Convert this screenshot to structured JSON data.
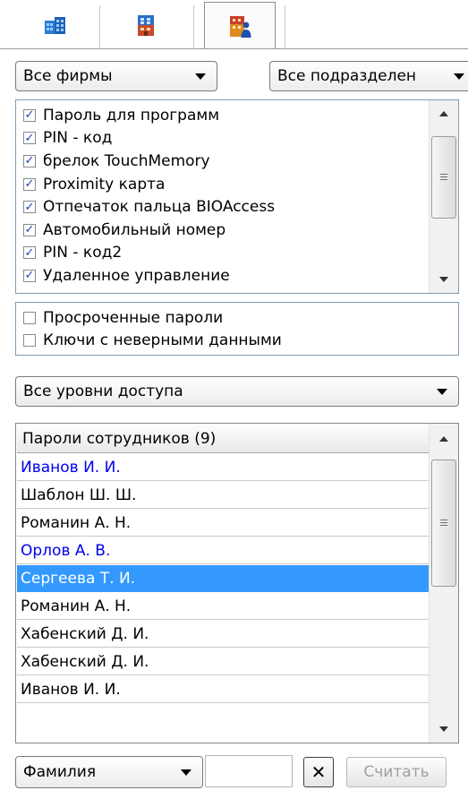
{
  "tabs": [
    {
      "icon": "buildings-icon",
      "active": false
    },
    {
      "icon": "building-icon",
      "active": false
    },
    {
      "icon": "building-person-icon",
      "active": true
    }
  ],
  "filters": {
    "company_select": "Все фирмы",
    "department_select": "Все подразделен"
  },
  "key_types": {
    "items": [
      {
        "label": "Пароль для программ",
        "checked": true
      },
      {
        "label": "PIN - код",
        "checked": true
      },
      {
        "label": "брелок TouchMemory",
        "checked": true
      },
      {
        "label": "Proximity карта",
        "checked": true
      },
      {
        "label": "Отпечаток пальца BIOAccess",
        "checked": true
      },
      {
        "label": "Автомобильный номер",
        "checked": true
      },
      {
        "label": "PIN - код2",
        "checked": true
      },
      {
        "label": "Удаленное управление",
        "checked": true
      }
    ]
  },
  "special_filters": {
    "items": [
      {
        "label": "Просроченные пароли",
        "checked": false
      },
      {
        "label": "Ключи с неверными данными",
        "checked": false
      }
    ]
  },
  "access_level_select": "Все уровни доступа",
  "employees": {
    "header": "Пароли сотрудников  (9)",
    "rows": [
      {
        "name": "Иванов И. И.",
        "color": "#0000ee",
        "selected": false
      },
      {
        "name": "Шаблон Ш. Ш.",
        "color": "#000000",
        "selected": false
      },
      {
        "name": "Романин А. Н.",
        "color": "#000000",
        "selected": false
      },
      {
        "name": "Орлов А. В.",
        "color": "#0000ee",
        "selected": false
      },
      {
        "name": "Сергеева Т. И.",
        "color": "#ffffff",
        "selected": true
      },
      {
        "name": "Романин А. Н.",
        "color": "#000000",
        "selected": false
      },
      {
        "name": "Хабенский Д. И.",
        "color": "#000000",
        "selected": false
      },
      {
        "name": "Хабенский Д. И.",
        "color": "#000000",
        "selected": false
      },
      {
        "name": "Иванов И. И.",
        "color": "#000000",
        "selected": false
      }
    ]
  },
  "bottom": {
    "field_select": "Фамилия",
    "search_value": "",
    "clear_label": "✕",
    "read_label": "Считать"
  },
  "colors": {
    "selection": "#3399ff",
    "link_blue": "#0000ee"
  }
}
